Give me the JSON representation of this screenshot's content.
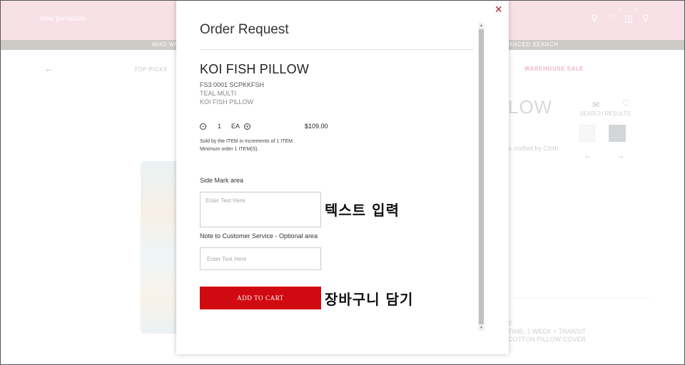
{
  "site": {
    "logo": "new furniture",
    "nav_left": "WHO WE",
    "nav_right": "ANCED SEARCH",
    "wishlist_count": "0",
    "cart_count": "0"
  },
  "subnav": {
    "back_arrow": "←",
    "top_picks": "TOP PICKS",
    "warehouse_sale": "WAREHOUSE SALE"
  },
  "background_product": {
    "title_fragment": "LOW",
    "search_results": "SEARCH RESULTS",
    "crafted_fragment": "e crafted by Cloth",
    "arrows": "← →",
    "details": [
      "T",
      "TIME: 1 WEEK + TRANSIT",
      "COTTON PILLOW COVER"
    ]
  },
  "modal": {
    "title": "Order Request",
    "close_icon": "×",
    "product": {
      "name": "KOI FISH PILLOW",
      "sku": "FS3 0001 SCPKKFSH",
      "color": "TEAL MULTI",
      "subtitle": "KOI FISH PILLOW"
    },
    "quantity": {
      "minus": "−",
      "plus": "+",
      "value": "1",
      "unit": "EA",
      "price": "$109.00"
    },
    "sold_by_line1": "Sold by the ITEM in Increments of 1 ITEM.",
    "sold_by_line2": "Minimum order 1 ITEM(S).",
    "side_mark": {
      "label": "Side Mark area",
      "placeholder": "Enter Text Here"
    },
    "note": {
      "label": "Note to Customer Service - Optional area",
      "placeholder": "Enter Text Here"
    },
    "add_to_cart": "ADD TO CART"
  },
  "annotations": {
    "text_input": "텍스트 입력",
    "add_to_cart": "장바구니 담기"
  },
  "colors": {
    "topbar": "#f2c6d3",
    "accent_red": "#d10a11",
    "sale_pink": "#e87a95"
  }
}
